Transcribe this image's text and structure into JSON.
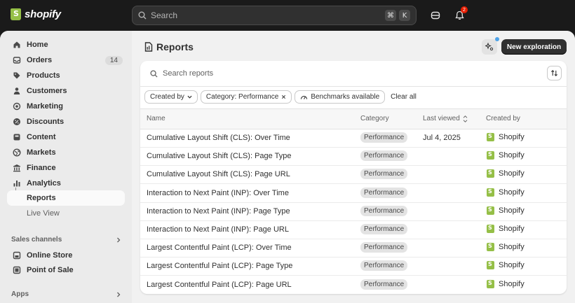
{
  "topbar": {
    "logo_text": "shopify",
    "search_placeholder": "Search",
    "shortcut_keys": [
      "⌘",
      "K"
    ],
    "notification_count": "2"
  },
  "sidebar": {
    "items": [
      {
        "label": "Home",
        "icon": "home-icon"
      },
      {
        "label": "Orders",
        "icon": "inbox-icon",
        "count": "14"
      },
      {
        "label": "Products",
        "icon": "tag-icon"
      },
      {
        "label": "Customers",
        "icon": "person-icon"
      },
      {
        "label": "Marketing",
        "icon": "target-icon"
      },
      {
        "label": "Discounts",
        "icon": "discount-icon"
      },
      {
        "label": "Content",
        "icon": "content-icon"
      },
      {
        "label": "Markets",
        "icon": "globe-icon"
      },
      {
        "label": "Finance",
        "icon": "bank-icon"
      },
      {
        "label": "Analytics",
        "icon": "chart-icon"
      }
    ],
    "sub_items": [
      {
        "label": "Reports",
        "active": true
      },
      {
        "label": "Live View",
        "active": false
      }
    ],
    "sales_channels_label": "Sales channels",
    "sales_channels": [
      {
        "label": "Online Store",
        "icon": "store-icon"
      },
      {
        "label": "Point of Sale",
        "icon": "pos-icon"
      }
    ],
    "apps_label": "Apps"
  },
  "page": {
    "title": "Reports",
    "new_button": "New exploration",
    "search_placeholder": "Search reports",
    "filters": {
      "created_by": "Created by",
      "category": "Category: Performance",
      "benchmarks": "Benchmarks available",
      "clear": "Clear all"
    },
    "columns": {
      "name": "Name",
      "category": "Category",
      "last_viewed": "Last viewed",
      "created_by": "Created by"
    },
    "rows": [
      {
        "name": "Cumulative Layout Shift (CLS): Over Time",
        "category": "Performance",
        "last_viewed": "Jul 4, 2025",
        "created_by": "Shopify"
      },
      {
        "name": "Cumulative Layout Shift (CLS): Page Type",
        "category": "Performance",
        "last_viewed": "",
        "created_by": "Shopify"
      },
      {
        "name": "Cumulative Layout Shift (CLS): Page URL",
        "category": "Performance",
        "last_viewed": "",
        "created_by": "Shopify"
      },
      {
        "name": "Interaction to Next Paint (INP): Over Time",
        "category": "Performance",
        "last_viewed": "",
        "created_by": "Shopify"
      },
      {
        "name": "Interaction to Next Paint (INP): Page Type",
        "category": "Performance",
        "last_viewed": "",
        "created_by": "Shopify"
      },
      {
        "name": "Interaction to Next Paint (INP): Page URL",
        "category": "Performance",
        "last_viewed": "",
        "created_by": "Shopify"
      },
      {
        "name": "Largest Contentful Paint (LCP): Over Time",
        "category": "Performance",
        "last_viewed": "",
        "created_by": "Shopify"
      },
      {
        "name": "Largest Contentful Paint (LCP): Page Type",
        "category": "Performance",
        "last_viewed": "",
        "created_by": "Shopify"
      },
      {
        "name": "Largest Contentful Paint (LCP): Page URL",
        "category": "Performance",
        "last_viewed": "",
        "created_by": "Shopify"
      }
    ]
  }
}
